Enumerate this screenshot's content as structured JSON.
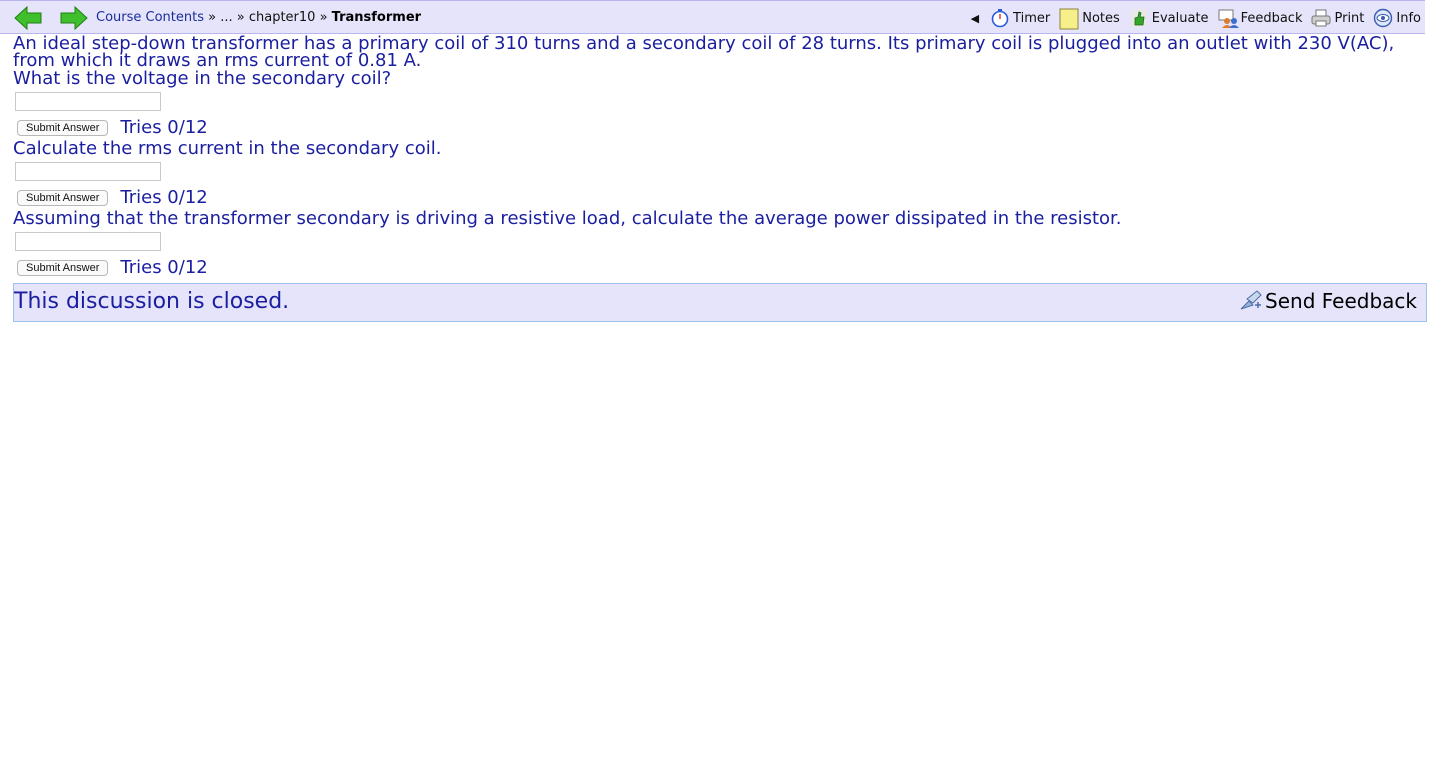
{
  "nav": {
    "back_icon": "green-left-arrow-icon",
    "forward_icon": "green-right-arrow-icon",
    "breadcrumb": {
      "root": "Course Contents",
      "sep1": " » ",
      "ellipsis": "...",
      "sep2": " » ",
      "chapter": "chapter10",
      "sep3": " » ",
      "current": "Transformer"
    },
    "collapse_glyph": "◀",
    "tools": [
      {
        "label": "Timer",
        "icon": "stopwatch-icon"
      },
      {
        "label": "Notes",
        "icon": "sticky-note-icon"
      },
      {
        "label": "Evaluate",
        "icon": "thumbs-up-icon"
      },
      {
        "label": "Feedback",
        "icon": "feedback-people-icon"
      },
      {
        "label": "Print",
        "icon": "printer-icon"
      },
      {
        "label": "Info",
        "icon": "info-eye-icon"
      }
    ]
  },
  "problem": {
    "intro": "An ideal step-down transformer has a primary coil of 310 turns and a secondary coil of 28 turns. Its primary coil is plugged into an outlet with 230 V(AC), from which it draws an rms current of 0.81 A.",
    "parts": [
      {
        "question": "What is the voltage in the secondary coil?",
        "input_value": "",
        "submit_label": "Submit Answer",
        "tries": "Tries 0/12"
      },
      {
        "question": "Calculate the rms current in the secondary coil.",
        "input_value": "",
        "submit_label": "Submit Answer",
        "tries": "Tries 0/12"
      },
      {
        "question": "Assuming that the transformer secondary is driving a resistive load, calculate the average power dissipated in the resistor.",
        "input_value": "",
        "submit_label": "Submit Answer",
        "tries": "Tries 0/12"
      }
    ]
  },
  "discussion": {
    "closed_text": "This discussion is closed.",
    "send_feedback_label": "Send Feedback",
    "send_feedback_icon": "send-feedback-icon"
  },
  "colors": {
    "bar_background": "#e6e4fa",
    "text_blue": "#1a1ea0",
    "arrow_green": "#3fbf2c"
  }
}
